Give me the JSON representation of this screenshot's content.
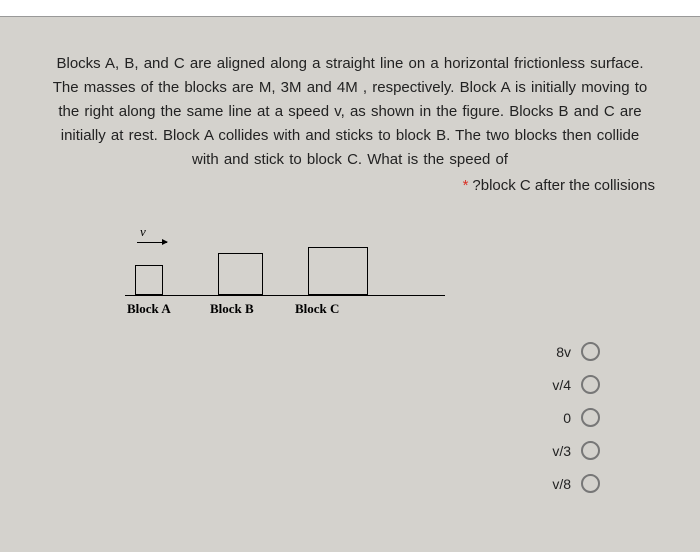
{
  "question": {
    "text": "Blocks A, B, and C are aligned along a straight line on a horizontal frictionless surface. The masses of the blocks are M, 3M and 4M , respectively. Block A is initially moving to the right along the same line at a speed v, as shown in the figure. Blocks B and C are initially at rest. Block A collides with and sticks to block B. The two blocks then collide with and stick to block C. What is the speed of",
    "trailing": "?block C after the collisions",
    "required_marker": "*"
  },
  "figure": {
    "velocity_symbol": "v",
    "block_labels": {
      "a": "Block A",
      "b": "Block B",
      "c": "Block C"
    }
  },
  "options": [
    {
      "label": "8v"
    },
    {
      "label": "v/4"
    },
    {
      "label": "0"
    },
    {
      "label": "v/3"
    },
    {
      "label": "v/8"
    }
  ]
}
